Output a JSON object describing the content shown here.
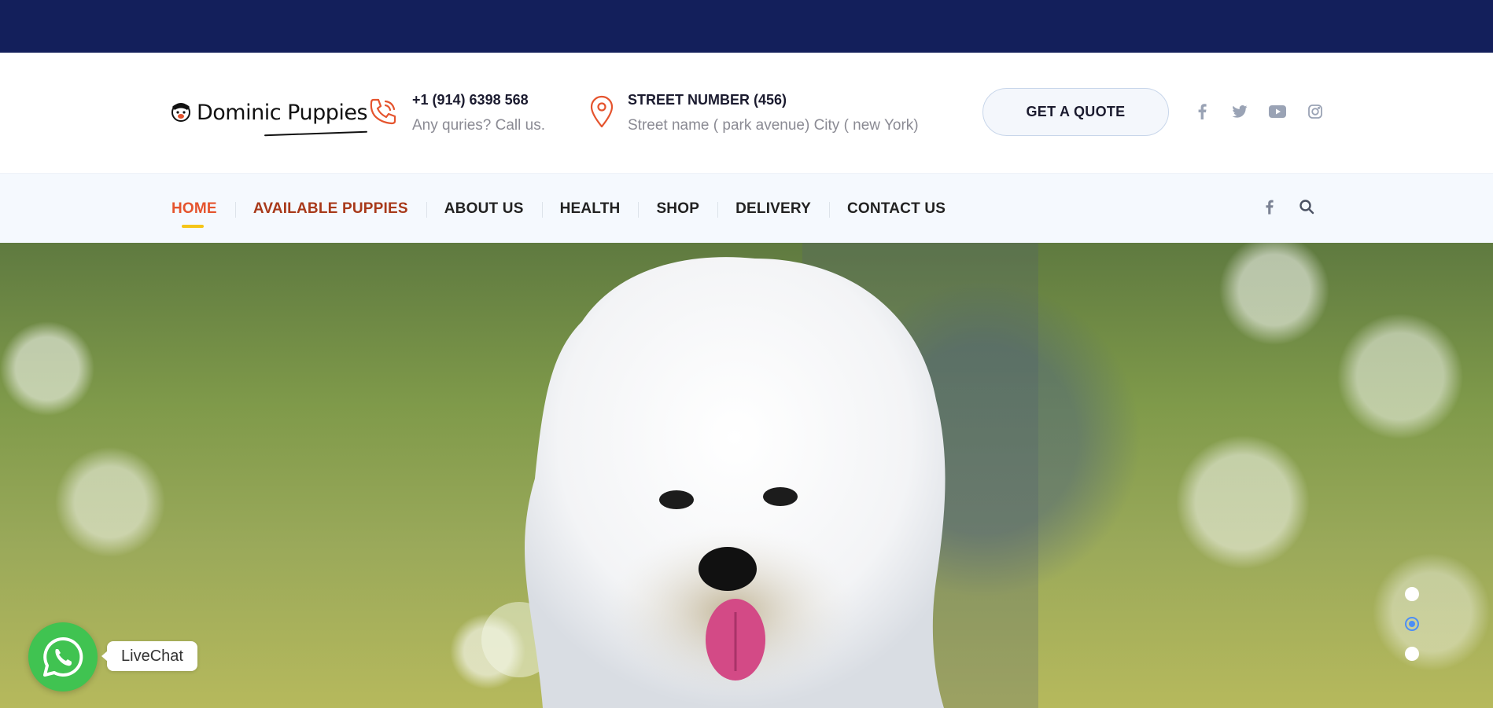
{
  "brand": {
    "name": "Dominic Puppies",
    "logo_icon": "puppy-face-icon"
  },
  "contact_phone": {
    "title": "+1 (914) 6398 568",
    "subtitle": "Any quries? Call us.",
    "icon": "phone-icon",
    "icon_color": "#e5542e"
  },
  "contact_address": {
    "title": "STREET NUMBER (456)",
    "subtitle": "Street name ( park avenue) City ( new York)",
    "icon": "map-pin-icon",
    "icon_color": "#e5542e"
  },
  "quote_button": {
    "label": "GET A QUOTE"
  },
  "socials": [
    "facebook-icon",
    "twitter-icon",
    "youtube-icon",
    "instagram-icon"
  ],
  "nav": {
    "items": [
      {
        "label": "HOME",
        "active": true
      },
      {
        "label": "AVAILABLE PUPPIES"
      },
      {
        "label": "ABOUT US"
      },
      {
        "label": "HEALTH"
      },
      {
        "label": "SHOP"
      },
      {
        "label": "DELIVERY"
      },
      {
        "label": "CONTACT US"
      }
    ],
    "right_icons": [
      "facebook-icon",
      "search-icon"
    ]
  },
  "slider": {
    "slides": 3,
    "active_index": 1
  },
  "livechat": {
    "label": "LiveChat",
    "icon": "whatsapp-icon"
  },
  "colors": {
    "topbar": "#131f5b",
    "accent": "#e5542e",
    "nav_active_underline": "#f5c518",
    "nav_bg": "#f5f9fe",
    "whatsapp": "#40c351",
    "slider_active": "#4c8ef6"
  }
}
